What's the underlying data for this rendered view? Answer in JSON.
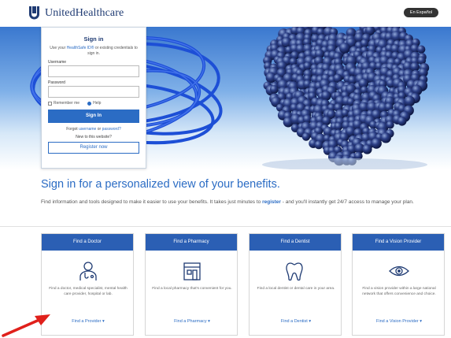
{
  "header": {
    "brand": "UnitedHealthcare",
    "language_button": "En Español"
  },
  "signin": {
    "title": "Sign in",
    "desc_before": "Use your ",
    "desc_link": "HealthSafe ID®",
    "desc_after": " or existing credentials to sign in.",
    "username_label": "Username",
    "username_value": "",
    "password_label": "Password",
    "password_value": "",
    "remember_label": "Remember me",
    "help_label": "Help",
    "signin_button": "Sign In",
    "forgot_text": "Forgot",
    "forgot_username": "username",
    "forgot_or": "or",
    "forgot_password": "password?",
    "new_text": "New to this website?",
    "register_button": "Register now"
  },
  "main": {
    "headline": "Sign in for a personalized view of your benefits.",
    "intro_before": "Find information and tools designed to make it easier to use your benefits. It takes just minutes to ",
    "intro_link": "register",
    "intro_after": " - and you'll instantly get 24/7 access to manage your plan."
  },
  "cards": [
    {
      "title": "Find a Doctor",
      "icon": "doctor-icon",
      "desc": "Find a doctor, medical specialist, mental health care provider, hospital or lab.",
      "link": "Find a Provider ▾"
    },
    {
      "title": "Find a Pharmacy",
      "icon": "pharmacy-icon",
      "desc": "Find a local pharmacy that's convenient for you.",
      "link": "Find a Pharmacy ▾"
    },
    {
      "title": "Find a Dentist",
      "icon": "tooth-icon",
      "desc": "Find a local dentist or dental care in your area.",
      "link": "Find a Dentist ▾"
    },
    {
      "title": "Find a Vision Provider",
      "icon": "eye-icon",
      "desc": "Find a vision provider within a large national network that offers convenience and choice.",
      "link": "Find a Vision Provider ▾"
    }
  ],
  "colors": {
    "brand_blue": "#2b6cc4",
    "card_header": "#2b5fb4",
    "logo_navy": "#1f3b73",
    "annotation_arrow": "#e0201b"
  }
}
